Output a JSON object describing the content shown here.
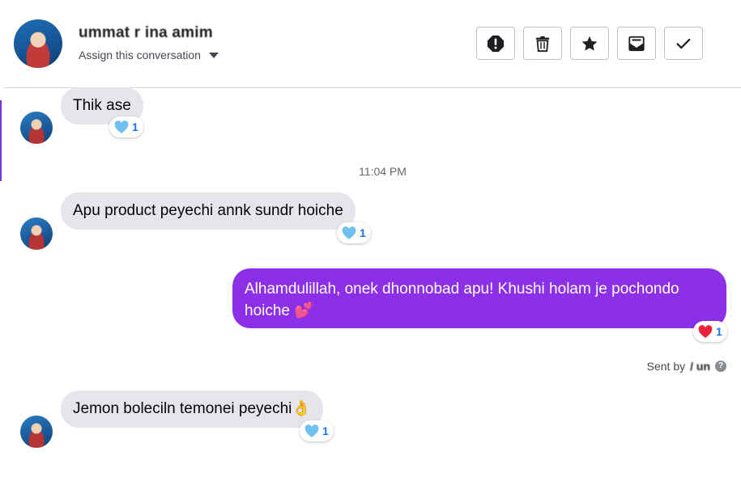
{
  "header": {
    "contact_name": "ummat r ina amim",
    "assign_label": "Assign this conversation",
    "actions": [
      {
        "name": "spam-button",
        "icon": "alert-icon"
      },
      {
        "name": "delete-button",
        "icon": "trash-icon"
      },
      {
        "name": "star-button",
        "icon": "star-icon"
      },
      {
        "name": "mark-unread-button",
        "icon": "envelope-icon"
      },
      {
        "name": "done-button",
        "icon": "check-icon"
      }
    ]
  },
  "messages": [
    {
      "direction": "in",
      "text": "Thik ase",
      "reaction": "blue-heart",
      "reaction_count": "1"
    },
    {
      "type": "timestamp",
      "text": "11:04 PM"
    },
    {
      "direction": "in",
      "text": "Apu product peyechi annk sundr hoiche",
      "reaction": "blue-heart",
      "reaction_count": "1"
    },
    {
      "direction": "out",
      "text": "Alhamdulillah, onek dhonnobad apu! Khushi holam je pochondo hoiche 💕",
      "reaction": "red-heart",
      "reaction_count": "1"
    },
    {
      "direction": "in",
      "text": "Jemon boleciln temonei peyechi👌",
      "reaction": "blue-heart",
      "reaction_count": "1"
    }
  ],
  "sent_by": {
    "prefix": "Sent by",
    "name": "/ un"
  },
  "colors": {
    "accent": "#8c2fe8",
    "incoming_bubble": "#e4e6eb",
    "blue_heart": "#6ec1ef",
    "red_heart": "#e8243c",
    "reaction_count": "#1877f2"
  }
}
